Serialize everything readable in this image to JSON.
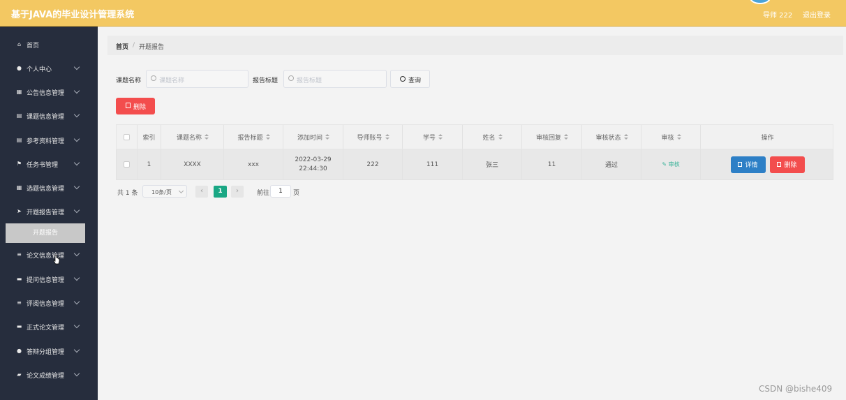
{
  "header": {
    "title": "基于JAVA的毕业设计管理系统",
    "user_label": "导师 222",
    "logout_label": "退出登录"
  },
  "sidebar": {
    "items": [
      {
        "label": "首页",
        "icon": "home-icon",
        "has_children": false
      },
      {
        "label": "个人中心",
        "icon": "user-icon",
        "has_children": true
      },
      {
        "label": "公告信息管理",
        "icon": "grid-icon",
        "has_children": true
      },
      {
        "label": "课题信息管理",
        "icon": "doc-icon",
        "has_children": true
      },
      {
        "label": "参考资料管理",
        "icon": "doc-icon",
        "has_children": true
      },
      {
        "label": "任务书管理",
        "icon": "flag-icon",
        "has_children": true
      },
      {
        "label": "选题信息管理",
        "icon": "grid-icon",
        "has_children": true
      },
      {
        "label": "开题报告管理",
        "icon": "send-icon",
        "has_children": true
      },
      {
        "label": "论文信息管理",
        "icon": "list-icon",
        "has_children": true
      },
      {
        "label": "提问信息管理",
        "icon": "monitor-icon",
        "has_children": true
      },
      {
        "label": "评阅信息管理",
        "icon": "list-icon",
        "has_children": true
      },
      {
        "label": "正式论文管理",
        "icon": "monitor-icon",
        "has_children": true
      },
      {
        "label": "答辩分组管理",
        "icon": "bulb-icon",
        "has_children": true
      },
      {
        "label": "论文成绩管理",
        "icon": "briefcase-icon",
        "has_children": true
      }
    ],
    "active_subitem": "开题报告"
  },
  "breadcrumb": {
    "home": "首页",
    "separator": "/",
    "current": "开题报告"
  },
  "search": {
    "topic_label": "课题名称",
    "topic_placeholder": "课题名称",
    "report_label": "报告标题",
    "report_placeholder": "报告标题",
    "query_label": "查询"
  },
  "toolbar": {
    "delete_label": "删除"
  },
  "table": {
    "columns": [
      "",
      "索引",
      "课题名称",
      "报告标题",
      "添加时间",
      "导师账号",
      "学号",
      "姓名",
      "审核回复",
      "审核状态",
      "审核",
      "操作"
    ],
    "rows": [
      {
        "index": "1",
        "topic": "XXXX",
        "report_title": "xxx",
        "added_time": "2022-03-29 22:44:30",
        "tutor_account": "222",
        "student_id": "111",
        "name": "张三",
        "audit_reply": "11",
        "audit_status": "通过",
        "audit_link": "审核",
        "detail_label": "详情",
        "delete_label": "删除"
      }
    ]
  },
  "pagination": {
    "total": "共 1 条",
    "page_size": "10条/页",
    "prev": "‹",
    "current_page": "1",
    "next": "›",
    "goto_label": "前往",
    "goto_value": "1",
    "page_suffix": "页"
  },
  "watermark": "CSDN @bishe409",
  "colors": {
    "header_bg": "#f3c862",
    "sidebar_bg": "#262d3d",
    "delete": "#f34d4d",
    "detail": "#2d7fc6",
    "pager_active": "#1aa784",
    "audit_link": "#3bb39a"
  }
}
